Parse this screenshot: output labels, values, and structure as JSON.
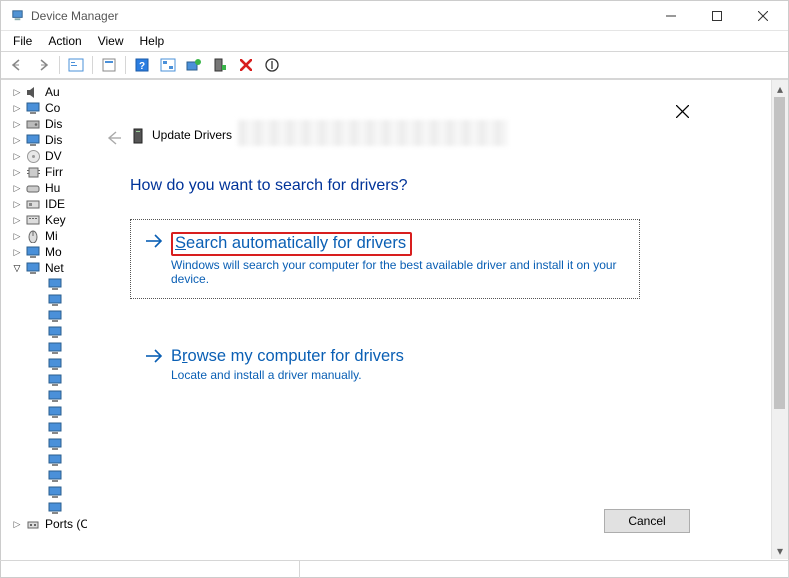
{
  "titlebar": {
    "title": "Device Manager"
  },
  "menu": {
    "file": "File",
    "action": "Action",
    "view": "View",
    "help": "Help"
  },
  "tree": {
    "items": [
      {
        "label": "Au"
      },
      {
        "label": "Co"
      },
      {
        "label": "Dis"
      },
      {
        "label": "Dis"
      },
      {
        "label": "DV"
      },
      {
        "label": "Firr"
      },
      {
        "label": "Hu"
      },
      {
        "label": "IDE"
      },
      {
        "label": "Key"
      },
      {
        "label": "Mi"
      },
      {
        "label": "Mo"
      },
      {
        "label": "Net",
        "expanded": true
      }
    ],
    "ports_label": "Ports (COM & LPT)"
  },
  "dialog": {
    "back_title": "Update Drivers",
    "heading": "How do you want to search for drivers?",
    "option1": {
      "title_leading": "S",
      "title_rest": "earch automatically for drivers",
      "subtitle": "Windows will search your computer for the best available driver and install it on your device."
    },
    "option2": {
      "title_leading": "B",
      "title_letter": "r",
      "title_rest": "owse my computer for drivers",
      "subtitle": "Locate and install a driver manually."
    },
    "cancel": "Cancel"
  }
}
